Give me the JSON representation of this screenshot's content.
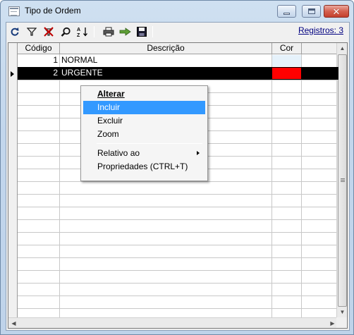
{
  "window": {
    "title": "Tipo de Ordem",
    "controls": {
      "minimize": "minimize",
      "maximize": "maximize",
      "close": "close"
    }
  },
  "toolbar": {
    "icons": [
      "refresh-icon",
      "filter-icon",
      "clear-filter-icon",
      "search-icon",
      "sort-icon",
      "print-icon",
      "export-icon",
      "save-icon"
    ],
    "registros_label": "Registros: 3"
  },
  "grid": {
    "columns": [
      {
        "label": "Código"
      },
      {
        "label": "Descrição"
      },
      {
        "label": "Cor"
      }
    ],
    "rows": [
      {
        "codigo": "1",
        "descricao": "NORMAL",
        "cor": "#e6f2fb",
        "selected": false
      },
      {
        "codigo": "2",
        "descricao": "URGENTE",
        "cor": "#ff0000",
        "selected": true
      }
    ]
  },
  "context_menu": {
    "items": {
      "alterar": "Alterar",
      "incluir": "Incluir",
      "excluir": "Excluir",
      "zoom": "Zoom",
      "relativo": "Relativo ao",
      "propriedades": "Propriedades (CTRL+T)"
    },
    "highlighted": "Incluir"
  },
  "colors": {
    "selection": "#000000",
    "menu_highlight": "#3399ff",
    "urgent": "#ff0000",
    "link": "#000080"
  }
}
